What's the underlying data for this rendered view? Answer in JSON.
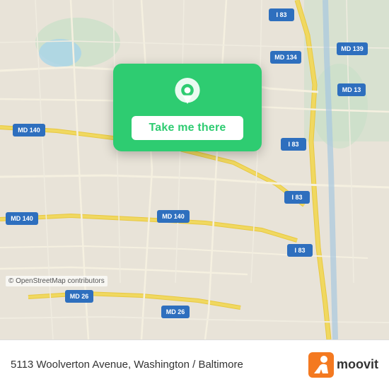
{
  "map": {
    "alt": "Street map of Washington / Baltimore area",
    "copyright": "© OpenStreetMap contributors"
  },
  "card": {
    "button_label": "Take me there",
    "pin_icon": "location-pin"
  },
  "info_bar": {
    "address": "5113 Woolverton Avenue, Washington / Baltimore",
    "logo_text": "moovit"
  },
  "route_badges": [
    {
      "label": "I 83",
      "color": "#2e7bc4"
    },
    {
      "label": "MD 134",
      "color": "#2e7bc4"
    },
    {
      "label": "MD 139",
      "color": "#2e7bc4"
    },
    {
      "label": "MD 140",
      "color": "#2e7bc4"
    },
    {
      "label": "MD 26",
      "color": "#2e7bc4"
    }
  ]
}
